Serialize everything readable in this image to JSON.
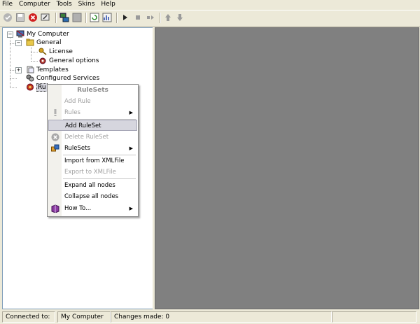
{
  "menu": [
    "File",
    "Computer",
    "Tools",
    "Skins",
    "Help"
  ],
  "toolbar_icons": [
    "check-icon",
    "save-icon",
    "stop-icon",
    "wizard-icon",
    "network-icon",
    "grid-icon",
    "refresh-icon",
    "chart-icon",
    "play-icon",
    "stop-square-icon",
    "step-icon",
    "up-arrow-icon",
    "down-arrow-icon"
  ],
  "tree": {
    "root": "My Computer",
    "general": "General",
    "license": "License",
    "general_options": "General options",
    "templates": "Templates",
    "configured_services": "Configured Services",
    "rules": "Ru"
  },
  "context_menu": {
    "title": "RuleSets",
    "items": [
      {
        "label": "Add Rule",
        "enabled": false
      },
      {
        "label": "Rules",
        "enabled": false,
        "submenu": true
      },
      {
        "label": "Add RuleSet",
        "enabled": true,
        "highlighted": true
      },
      {
        "label": "Delete RuleSet",
        "enabled": false
      },
      {
        "label": "RuleSets",
        "enabled": true,
        "submenu": true
      },
      {
        "label": "Import from XMLFile",
        "enabled": true
      },
      {
        "label": "Export to XMLFile",
        "enabled": false
      },
      {
        "label": "Expand all nodes",
        "enabled": true
      },
      {
        "label": "Collapse all nodes",
        "enabled": true
      },
      {
        "label": "How To...",
        "enabled": true,
        "submenu": true
      }
    ]
  },
  "status": {
    "connected_label": "Connected to:",
    "computer": "My Computer",
    "changes": "Changes made: 0"
  },
  "colors": {
    "chrome": "#ece9d8",
    "right_panel": "#808080",
    "highlight": "#d6d6de"
  }
}
